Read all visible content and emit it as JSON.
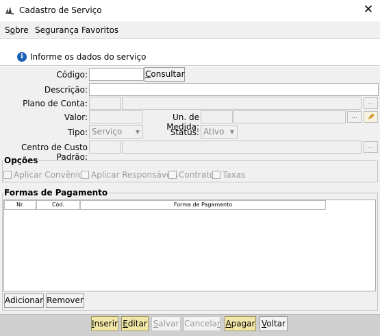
{
  "window": {
    "title": "Cadastro de Serviço",
    "close_glyph": "✕"
  },
  "menu": {
    "sobre_pre": "S",
    "sobre_ul": "o",
    "sobre_post": "bre",
    "seguranca": "Segurança",
    "favoritos": "Favoritos"
  },
  "info": {
    "text": "Informe os dados do serviço",
    "icon": "info-icon",
    "icon_glyph": "i"
  },
  "form": {
    "codigo_label": "Código:",
    "codigo_value": "",
    "consultar_ul": "C",
    "consultar_rest": "onsultar",
    "descricao_label": "Descrição:",
    "descricao_value": "",
    "plano_label": "Plano de Conta:",
    "plano_code": "",
    "plano_name": "",
    "valor_label": "Valor:",
    "valor_value": "",
    "unmedida_label": "Un. de Medida:",
    "unmedida_code": "",
    "unmedida_name": "",
    "tipo_label": "Tipo:",
    "tipo_value": "Serviço",
    "status_label": "Status:",
    "status_value": "Ativo",
    "centro_label": "Centro de Custo Padrão:",
    "centro_code": "",
    "centro_name": "",
    "ellipsis": "..."
  },
  "opcoes": {
    "title": "Opções",
    "items": [
      "Aplicar Convênios",
      "Aplicar Responsáveis",
      "Contrato",
      "Taxas"
    ]
  },
  "pagamento": {
    "title": "Formas de Pagamento",
    "columns": [
      "Nr.",
      "Cód.",
      "Forma de Pagamento"
    ],
    "adicionar": "Adicionar",
    "remover": "Remover"
  },
  "bottom": {
    "inserir_ul": "I",
    "inserir_rest": "nserir",
    "editar_ul": "E",
    "editar_rest": "ditar",
    "salvar_ul": "S",
    "salvar_rest": "alvar",
    "cancelar_pre": "Cancela",
    "cancelar_ul": "r",
    "apagar_ul": "A",
    "apagar_rest": "pagar",
    "voltar_ul": "V",
    "voltar_rest": "oltar"
  },
  "colors": {
    "info_blue": "#1a5fb4",
    "action_yellow": "#f2e7a8",
    "edit_icon": "#e8a020"
  }
}
